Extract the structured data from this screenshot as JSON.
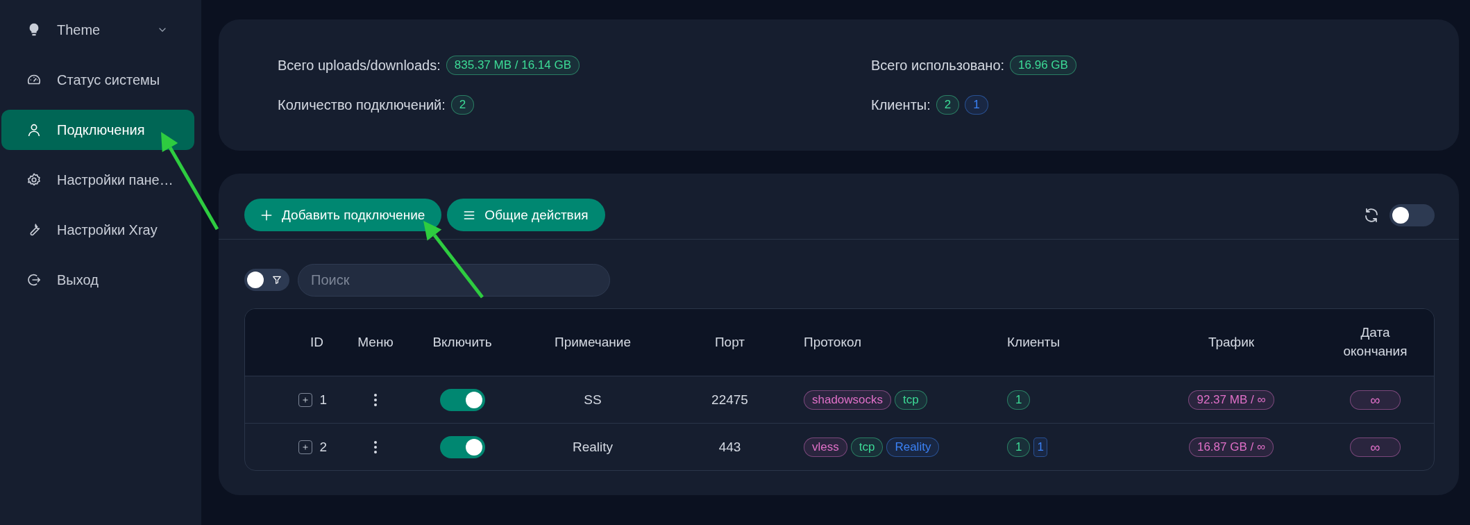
{
  "sidebar": {
    "items": [
      {
        "label": "Theme",
        "kind": "submenu",
        "expanded": false,
        "selected": false
      },
      {
        "label": "Статус системы",
        "kind": "link",
        "selected": false
      },
      {
        "label": "Подключения",
        "kind": "link",
        "selected": true
      },
      {
        "label": "Настройки пане…",
        "kind": "link",
        "selected": false
      },
      {
        "label": "Настройки Xray",
        "kind": "link",
        "selected": false
      },
      {
        "label": "Выход",
        "kind": "link",
        "selected": false
      }
    ]
  },
  "stats": [
    {
      "label": "Всего uploads/downloads:",
      "values": [
        {
          "text": "835.37 MB / 16.14 GB",
          "color": "#3ddc97"
        }
      ]
    },
    {
      "label": "Всего использовано:",
      "values": [
        {
          "text": "16.96 GB",
          "color": "#3ddc97"
        }
      ]
    },
    {
      "label": "Количество подключений:",
      "values": [
        {
          "text": "2",
          "color": "#3ddc97"
        }
      ]
    },
    {
      "label": "Клиенты:",
      "values": [
        {
          "text": "2",
          "color": "#3ddc97"
        },
        {
          "text": "1",
          "color": "#3b82f6"
        }
      ]
    }
  ],
  "toolbar": {
    "buttons": [
      {
        "label": "Добавить подключение"
      },
      {
        "label": "Общие действия"
      }
    ],
    "auto_refresh": {
      "on": false
    }
  },
  "filter": {
    "on": false
  },
  "search": {
    "placeholder": "Поиск"
  },
  "table": {
    "columns": [
      "ID",
      "Меню",
      "Включить",
      "Примечание",
      "Порт",
      "Протокол",
      "Клиенты",
      "Трафик",
      "Дата окончания"
    ],
    "rows": [
      {
        "expanded": false,
        "id": "1",
        "enabled": true,
        "remark": "SS",
        "port": "22475",
        "protocol": [
          {
            "text": "shadowsocks",
            "color": "#e070c8"
          },
          {
            "text": "tcp",
            "color": "#3ddc97"
          }
        ],
        "clients": [
          {
            "text": "1",
            "color": "#3ddc97"
          }
        ],
        "traffic": "92.37 MB / ∞",
        "expiry": "∞"
      },
      {
        "expanded": false,
        "id": "2",
        "enabled": true,
        "remark": "Reality",
        "port": "443",
        "protocol": [
          {
            "text": "vless",
            "color": "#e070c8"
          },
          {
            "text": "tcp",
            "color": "#3ddc97"
          },
          {
            "text": "Reality",
            "color": "#3b82f6"
          }
        ],
        "clients": [
          {
            "text": "1",
            "color": "#3ddc97"
          },
          {
            "text": "1",
            "color": "#3b82f6"
          }
        ],
        "traffic": "16.87 GB / ∞",
        "expiry": "∞"
      }
    ]
  },
  "annotations": [
    {
      "kind": "arrow"
    },
    {
      "kind": "arrow"
    }
  ]
}
